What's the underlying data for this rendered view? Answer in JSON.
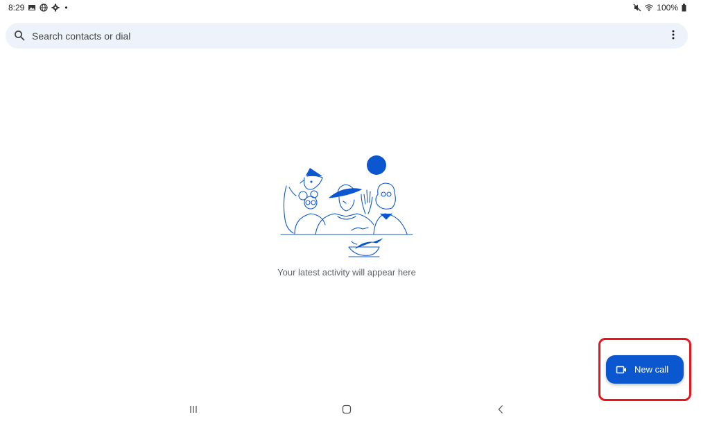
{
  "status_bar": {
    "time": "8:29",
    "left_icons": [
      "image-icon",
      "globe-icon",
      "settings-icon"
    ],
    "dot": "•",
    "right_icons": [
      "mute-icon",
      "wifi-icon",
      "battery-icon"
    ],
    "battery": "100%"
  },
  "search": {
    "placeholder": "Search contacts or dial",
    "value": ""
  },
  "empty_state": {
    "message": "Your latest activity will appear here"
  },
  "fab": {
    "label": "New call",
    "icon": "video-camera-icon"
  },
  "navigation": {
    "buttons": [
      "recent-apps-icon",
      "home-icon",
      "back-icon"
    ]
  },
  "colors": {
    "accent": "#0b57d0",
    "search_bg": "#eef2fa",
    "highlight": "#e8141b"
  }
}
